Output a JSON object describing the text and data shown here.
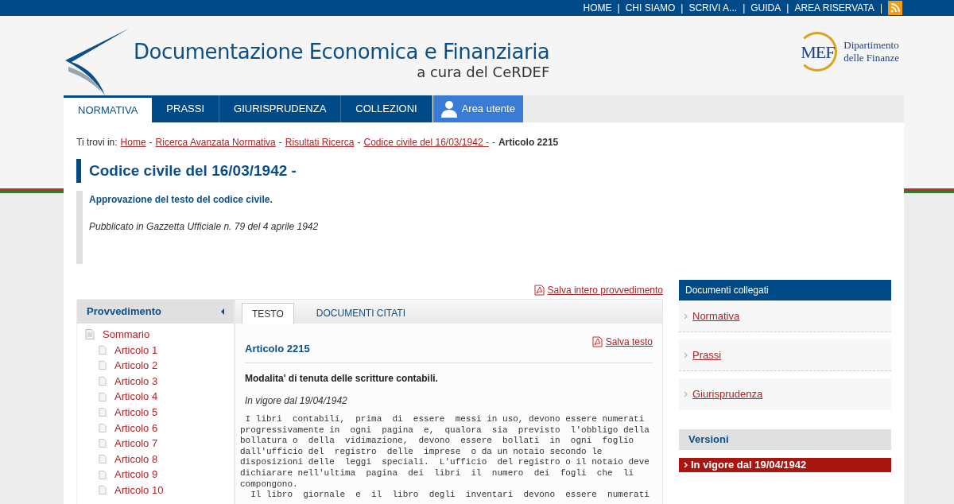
{
  "top_links": {
    "items": [
      "HOME",
      "CHI SIAMO",
      "SCRIVI A...",
      "GUIDA",
      "AREA RISERVATA"
    ],
    "separator": "|"
  },
  "logo": {
    "title": "Documentazione Economica e Finanziaria",
    "subtitle": "a cura del CeRDEF"
  },
  "mef": {
    "mark": "MEF",
    "lines": [
      "Dipartimento",
      "delle Finanze"
    ]
  },
  "nav": [
    {
      "label": "NORMATIVA",
      "selected": true,
      "kind": "tab"
    },
    {
      "label": "PRASSI",
      "selected": false,
      "kind": "tab"
    },
    {
      "label": "GIURISPRUDENZA",
      "selected": false,
      "kind": "tab"
    },
    {
      "label": "COLLEZIONI",
      "selected": false,
      "kind": "tab"
    },
    {
      "label": "Area utente",
      "selected": false,
      "kind": "user"
    }
  ],
  "breadcrumb": {
    "prefix": "Ti trovi in:",
    "links": [
      {
        "label": "Home",
        "separator": "-"
      },
      {
        "label": "Ricerca Avanzata Normativa",
        "separator": "-"
      },
      {
        "label": "Risultati Ricerca",
        "separator": "-"
      },
      {
        "label": "Codice civile del 16/03/1942 -",
        "separator": "-"
      }
    ],
    "current": "Articolo 2215"
  },
  "title": "Codice civile del 16/03/1942 -",
  "summary": {
    "heading": "Approvazione del testo del codice civile.",
    "published": "Pubblicato in Gazzetta Ufficiale n. 79 del 4 aprile 1942"
  },
  "save_all": "Salva intero provvedimento",
  "sidebar": {
    "title": "Provvedimento",
    "items": [
      {
        "label": "Sommario",
        "children": [
          {
            "label": "Articolo 1"
          },
          {
            "label": "Articolo 2"
          },
          {
            "label": "Articolo 3"
          },
          {
            "label": "Articolo 4"
          },
          {
            "label": "Articolo 5"
          },
          {
            "label": "Articolo 6"
          },
          {
            "label": "Articolo 7"
          },
          {
            "label": "Articolo 8"
          },
          {
            "label": "Articolo 9"
          },
          {
            "label": "Articolo 10"
          }
        ]
      }
    ]
  },
  "tabs": [
    {
      "label": "TESTO",
      "selected": true
    },
    {
      "label": "DOCUMENTI CITATI",
      "selected": false
    }
  ],
  "article": {
    "title": "Articolo 2215",
    "save_link": "Salva testo",
    "heading": "Modalita' di tenuta delle scritture contabili.",
    "in_force": "In vigore dal 19/04/1942",
    "lines": [
      " I libri  contabili,  prima  di  essere  messi in uso, devono essere numerati",
      "progressivamente in  ogni  pagina  e,  qualora  sia  previsto  l'obbligo della",
      "bollatura o  della  vidimazione,  devono  essere  bollati  in  ogni  foglio",
      "dall'ufficio del  registro  delle  imprese  o da un notaio secondo le",
      "disposizioni delle  leggi  speciali.  L'ufficio  del registro o il notaio deve",
      "dichiarare nell'ultima  pagina  dei  libri  il  numero  dei  fogli  che  li",
      "compongono.",
      "  Il libro  giornale  e  il  libro  degli  inventari  devono  essere  numerati"
    ]
  },
  "documents": {
    "title": "Documenti collegati",
    "links": [
      "Normativa",
      "Prassi",
      "Giurisprudenza"
    ]
  },
  "versions": {
    "title": "Versioni",
    "items": [
      {
        "label": "In vigore dal 19/04/1942",
        "selected": true
      }
    ]
  }
}
